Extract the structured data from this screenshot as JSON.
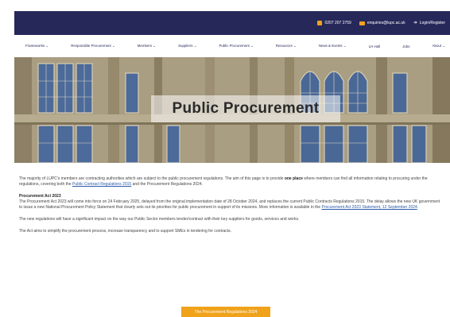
{
  "topbar": {
    "phone": "0207 207 2759",
    "email": "enquiries@lupc.ac.uk",
    "login": "Login/Register"
  },
  "nav": [
    "Frameworks ⌄",
    "Responsible Procurement ⌄",
    "Members ⌄",
    "Suppliers ⌄",
    "Public Procurement ⌄",
    "Resources ⌄",
    "News & Events ⌄",
    "LH Hall",
    "Jobs",
    "About ⌄"
  ],
  "hero": {
    "title": "Public Procurement"
  },
  "content": {
    "intro_1": "The majority of LUPC's members are contracting authorities which are subject to the public procurement regulations. The aim of this page is to provide ",
    "intro_bold": "one place",
    "intro_2": " where members can find all information relating to procuring under the regulations, covering both the ",
    "intro_link": "Public Contract Regulations 2015",
    "intro_3": " and the Procurement Regulations 2024.",
    "act_heading": "Procurement Act 2023",
    "act_1": "The Procurement Act 2023 will come into force on 24 February 2025, delayed from the original implementation date of 28 October 2024, and replaces the current Public Contracts Regulations 2015. The delay allows the new UK government to issue a new National Procurement Policy Statement that clearly sets out its priorities for public procurement in support of its missions. More information is available in the ",
    "act_link": "Procurement Act 2023 Statement, 12 September 2024",
    "act_2": ".",
    "para_3": "The new regulations will have a significant impact on the way our Public Sector members tender/contract with their key suppliers for goods, services and works.",
    "para_4": "The Act aims to simplify the procurement process, increase transparency and to support SMEs in tendering for contracts."
  },
  "cta": {
    "label": "The Procurement Regulations 2024"
  }
}
